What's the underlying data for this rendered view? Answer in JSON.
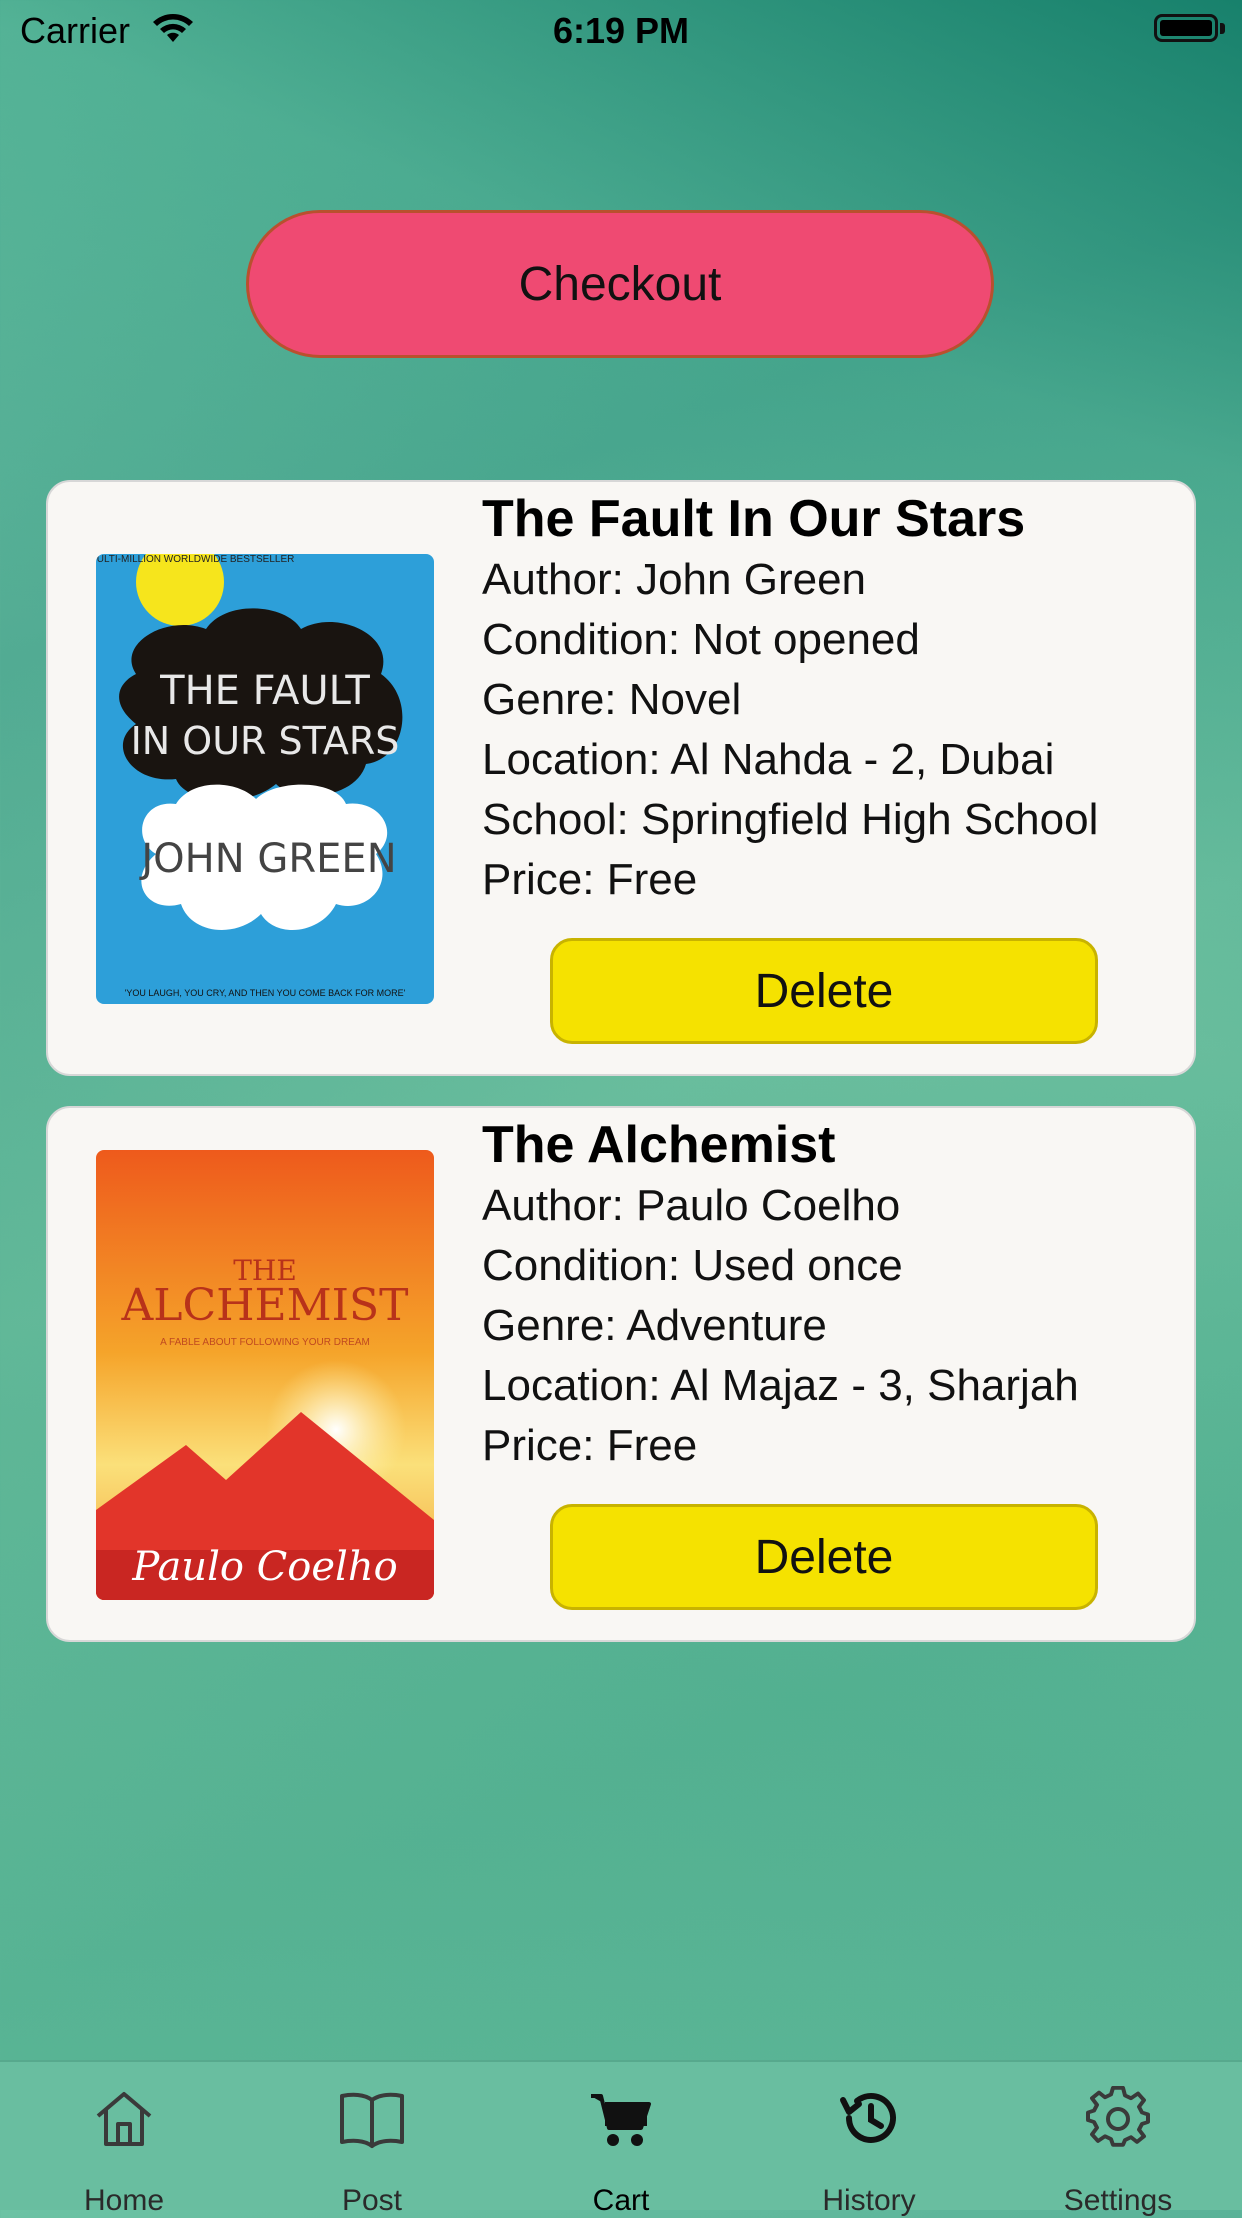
{
  "status_bar": {
    "carrier": "Carrier",
    "time": "6:19 PM"
  },
  "checkout_label": "Checkout",
  "cart_items": [
    {
      "title": "The Fault In Our Stars",
      "author": "Author: John Green",
      "condition": "Condition: Not opened",
      "genre": "Genre: Novel",
      "location": "Location: Al Nahda - 2, Dubai",
      "school": "School: Springfield High School",
      "price": "Price: Free",
      "delete_label": "Delete",
      "cover": {
        "top_text": "THE MULTI-MILLION WORLDWIDE BESTSELLER",
        "title_line1": "THE FAULT",
        "title_line2": "IN OUR STARS",
        "author": "JOHN GREEN",
        "tagline": "'YOU LAUGH, YOU CRY, AND THEN YOU COME BACK FOR MORE'",
        "color": "#2d9fd9"
      }
    },
    {
      "title": "The Alchemist",
      "author": "Author: Paulo Coelho",
      "condition": "Condition: Used once",
      "genre": "Genre: Adventure",
      "location": "Location: Al Majaz - 3, Sharjah",
      "price": "Price: Free",
      "delete_label": "Delete",
      "cover": {
        "title_line1": "THE",
        "title_line2": "ALCHEMIST",
        "subtitle": "A FABLE ABOUT FOLLOWING YOUR DREAM",
        "author": "Paulo Coelho",
        "color": "#f07a1f"
      }
    }
  ],
  "tabs": [
    {
      "label": "Home",
      "icon": "home-icon"
    },
    {
      "label": "Post",
      "icon": "book-icon"
    },
    {
      "label": "Cart",
      "icon": "cart-icon",
      "active": true
    },
    {
      "label": "History",
      "icon": "history-icon"
    },
    {
      "label": "Settings",
      "icon": "gear-icon"
    }
  ],
  "colors": {
    "checkout": "#ef4a72",
    "delete": "#f5e200",
    "card": "#f9f7f4",
    "tabbar": "#69bea0"
  }
}
